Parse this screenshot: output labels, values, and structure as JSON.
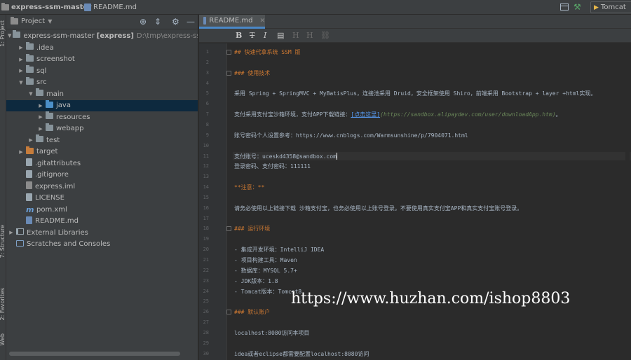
{
  "topbar": {
    "project_name": "express-ssm-master",
    "file_name": "README.md",
    "run_config": "Tomcat"
  },
  "left_strip": {
    "project_label": "1: Project",
    "structure_label": "7: Structure",
    "favorites_label": "2: Favorites",
    "web_label": "Web"
  },
  "project_panel": {
    "title": "Project",
    "tree": [
      {
        "label": ".idea",
        "indent": 1,
        "arrow": "▶",
        "icon": "folder-gray"
      },
      {
        "label": "screenshot",
        "indent": 1,
        "arrow": "▶",
        "icon": "folder-gray"
      },
      {
        "label": "sql",
        "indent": 1,
        "arrow": "▶",
        "icon": "folder-gray"
      },
      {
        "label": "src",
        "indent": 1,
        "arrow": "▼",
        "icon": "folder-gray"
      },
      {
        "label": "main",
        "indent": 2,
        "arrow": "▼",
        "icon": "folder-gray"
      },
      {
        "label": "java",
        "indent": 3,
        "arrow": "▶",
        "icon": "folder-blue",
        "selected": true
      },
      {
        "label": "resources",
        "indent": 3,
        "arrow": "▶",
        "icon": "folder-gray"
      },
      {
        "label": "webapp",
        "indent": 3,
        "arrow": "▶",
        "icon": "folder-gray"
      },
      {
        "label": "test",
        "indent": 2,
        "arrow": "▶",
        "icon": "folder-gray"
      },
      {
        "label": "target",
        "indent": 1,
        "arrow": "▶",
        "icon": "folder-orange"
      },
      {
        "label": ".gitattributes",
        "indent": 1,
        "arrow": "",
        "icon": "file"
      },
      {
        "label": ".gitignore",
        "indent": 1,
        "arrow": "",
        "icon": "file"
      },
      {
        "label": "express.iml",
        "indent": 1,
        "arrow": "",
        "icon": "file-iml"
      },
      {
        "label": "LICENSE",
        "indent": 1,
        "arrow": "",
        "icon": "file"
      },
      {
        "label": "pom.xml",
        "indent": 1,
        "arrow": "",
        "icon": "maven"
      },
      {
        "label": "README.md",
        "indent": 1,
        "arrow": "",
        "icon": "file-md"
      },
      {
        "label": "External Libraries",
        "indent": 0,
        "arrow": "▶",
        "icon": "library"
      },
      {
        "label": "Scratches and Consoles",
        "indent": 0,
        "arrow": "",
        "icon": "scratch"
      }
    ],
    "root": {
      "label": "express-ssm-master",
      "module": "[express]",
      "path": "D:\\tmp\\express-ssm-m"
    }
  },
  "editor": {
    "tab_label": "README.md",
    "toolbar": {
      "bold": "B",
      "strike": "T",
      "italic": "I",
      "code": "▤",
      "h1": "H",
      "h2": "H",
      "link": "⛓"
    },
    "lines": [
      {
        "n": "1",
        "html": "## 快速代拿系统 SSM 版",
        "type": "hdr2"
      },
      {
        "n": "2",
        "html": ""
      },
      {
        "n": "3",
        "html": "### 使用技术",
        "type": "hdr3"
      },
      {
        "n": "4",
        "html": ""
      },
      {
        "n": "5",
        "html": "采用 Spring + SpringMVC + MyBatisPlus，连接池采用 Druid，安全框架使用 Shiro，前端采用 Bootstrap + layer +html实现。"
      },
      {
        "n": "6",
        "html": ""
      },
      {
        "n": "7",
        "html": "支付采用支付宝沙箱环境，支付APP下载链接：",
        "link": "[点击这里]",
        "url": "(https://sandbox.alipaydev.com/user/downloadApp.htm)",
        "tail": "。"
      },
      {
        "n": "8",
        "html": ""
      },
      {
        "n": "9",
        "html": "账号密码个人设置参考：https://www.cnblogs.com/Warmsunshine/p/7904071.html"
      },
      {
        "n": "10",
        "html": ""
      },
      {
        "n": "11",
        "html": "支付账号：uceskd4358@sandbox.com",
        "caret": true
      },
      {
        "n": "12",
        "html": "登录密码、支付密码：111111"
      },
      {
        "n": "13",
        "html": ""
      },
      {
        "n": "14",
        "html": "**注意：**",
        "type": "bold"
      },
      {
        "n": "15",
        "html": ""
      },
      {
        "n": "16",
        "html": "请务必使用以上链接下载 沙箱支付宝，也务必使用以上账号登录。不要使用真实支付宝APP和真实支付宝账号登录。"
      },
      {
        "n": "17",
        "html": ""
      },
      {
        "n": "18",
        "html": "### 运行环境",
        "type": "hdr3"
      },
      {
        "n": "19",
        "html": ""
      },
      {
        "n": "20",
        "html": "- 集成开发环境：IntelliJ IDEA"
      },
      {
        "n": "21",
        "html": "- 项目构建工具：Maven"
      },
      {
        "n": "22",
        "html": "- 数据库：MYSQL 5.7+"
      },
      {
        "n": "23",
        "html": "- JDK版本：1.8"
      },
      {
        "n": "24",
        "html": "- Tomcat版本：Tomcat8"
      },
      {
        "n": "25",
        "html": ""
      },
      {
        "n": "26",
        "html": "### 默认账户",
        "type": "hdr3"
      },
      {
        "n": "27",
        "html": ""
      },
      {
        "n": "28",
        "html": "localhost:8080访问本项目"
      },
      {
        "n": "29",
        "html": ""
      },
      {
        "n": "30",
        "html": "idea或者eclipse都需要配置localhost:8080访问"
      }
    ]
  },
  "watermark": "https://www.huzhan.com/ishop8803"
}
